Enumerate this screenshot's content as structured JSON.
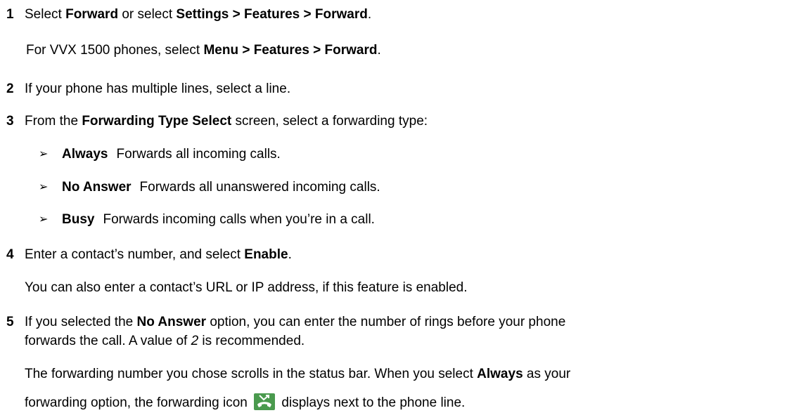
{
  "steps": [
    {
      "number": "1",
      "text": [
        {
          "t": "Select "
        },
        {
          "t": "Forward",
          "b": true
        },
        {
          "t": " or select "
        },
        {
          "t": "Settings > Features > Forward",
          "b": true
        },
        {
          "t": "."
        }
      ],
      "notes": [
        [
          {
            "t": "For VVX 1500 phones, select "
          },
          {
            "t": "Menu > Features > Forward",
            "b": true
          },
          {
            "t": "."
          }
        ]
      ]
    },
    {
      "number": "2",
      "text": [
        {
          "t": "If your phone has multiple lines, select a line."
        }
      ]
    },
    {
      "number": "3",
      "text": [
        {
          "t": "From the "
        },
        {
          "t": "Forwarding Type Select",
          "b": true
        },
        {
          "t": " screen, select a forwarding type:"
        }
      ],
      "bullets": [
        {
          "term": "Always",
          "desc": "Forwards all incoming calls."
        },
        {
          "term": "No Answer",
          "desc": "Forwards all unanswered incoming calls."
        },
        {
          "term": "Busy",
          "desc": "Forwards incoming calls when you’re in a call."
        }
      ]
    },
    {
      "number": "4",
      "text": [
        {
          "t": "Enter a contact’s number, and select "
        },
        {
          "t": "Enable",
          "b": true
        },
        {
          "t": "."
        }
      ],
      "notes": [
        [
          {
            "t": "You can also enter a contact’s URL or IP address, if this feature is enabled."
          }
        ]
      ]
    },
    {
      "number": "5",
      "text_line1": [
        {
          "t": "If you selected the "
        },
        {
          "t": "No Answer",
          "b": true
        },
        {
          "t": " option, you can enter the number of rings before your phone"
        }
      ],
      "text_line2": [
        {
          "t": "forwards the call. A value of "
        },
        {
          "t": "2",
          "i": true
        },
        {
          "t": " is recommended."
        }
      ],
      "note_line1": [
        {
          "t": "The forwarding number you chose scrolls in the status bar. When you select "
        },
        {
          "t": "Always",
          "b": true
        },
        {
          "t": " as your"
        }
      ],
      "note_line2_before": "forwarding option, the forwarding icon",
      "note_line2_after": "displays next to the phone line."
    }
  ],
  "bullet_marker": "➢",
  "icon": {
    "name": "call-forward-icon",
    "bg": "#4a9a4e",
    "fg": "#ffffff"
  }
}
